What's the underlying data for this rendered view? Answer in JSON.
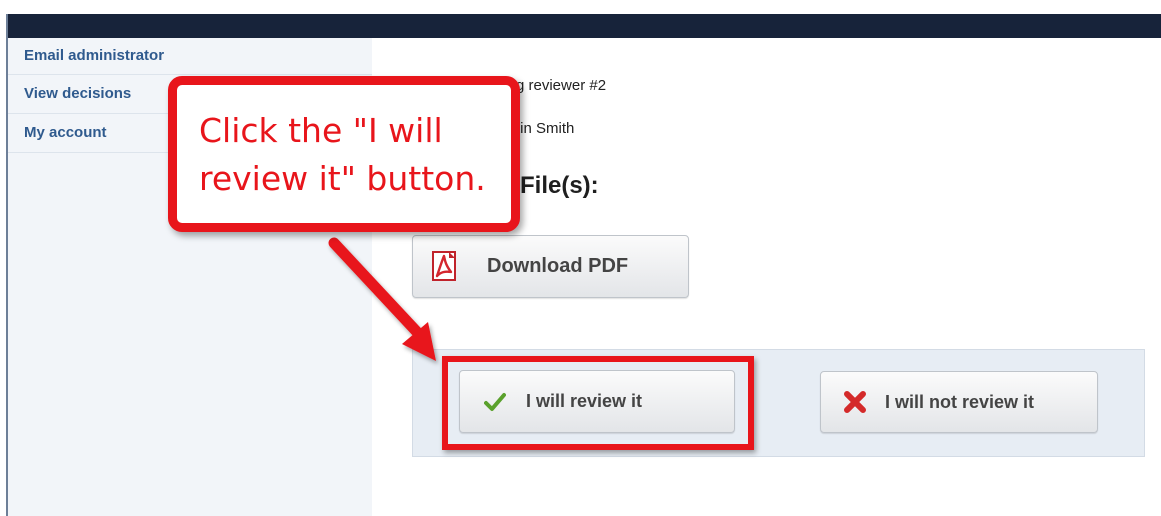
{
  "sidebar": {
    "items": [
      {
        "label": "Email administrator"
      },
      {
        "label": "View decisions"
      },
      {
        "label": "My account"
      }
    ]
  },
  "assignment": {
    "reviewer_text": "g reviewer #2",
    "author_text": "tin Smith"
  },
  "files": {
    "heading": "File(s):",
    "download_label": "Download PDF",
    "download_icon": "pdf-icon"
  },
  "decision": {
    "accept_label": "I will review it",
    "accept_icon": "checkmark-icon",
    "decline_label": "I will not review it",
    "decline_icon": "x-icon"
  },
  "annotation": {
    "callout_text": "Click the \"I will review it\" button.",
    "color": "#e8151b"
  },
  "colors": {
    "topbar": "#17233a",
    "sidebar_bg": "#f2f5f9",
    "link": "#2f5a8e",
    "panel_bg": "#e7edf4"
  }
}
